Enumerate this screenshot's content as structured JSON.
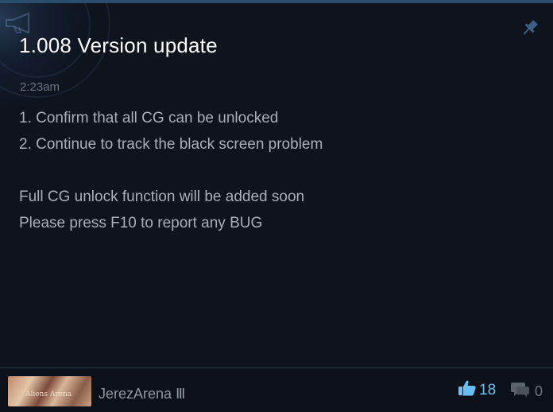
{
  "post": {
    "title": "1.008 Version update",
    "time": "2:23am",
    "lines": [
      "1. Confirm that all CG can be unlocked",
      "2. Continue to track the black screen problem",
      "",
      "Full CG unlock function will be added soon",
      "Please press F10 to report any BUG"
    ]
  },
  "footer": {
    "author": "JerezArena Ⅲ",
    "avatar_text": "Aliens Arena",
    "likes": "18",
    "comments": "0"
  },
  "colors": {
    "background": "#0e131c",
    "title": "#ffffff",
    "body_text": "#a9afb8",
    "muted": "#6b7480",
    "accent": "#66c0f4"
  },
  "icons": {
    "announcement": "megaphone-icon",
    "pin": "pin-icon",
    "like": "thumbs-up-icon",
    "comment": "comment-icon"
  }
}
